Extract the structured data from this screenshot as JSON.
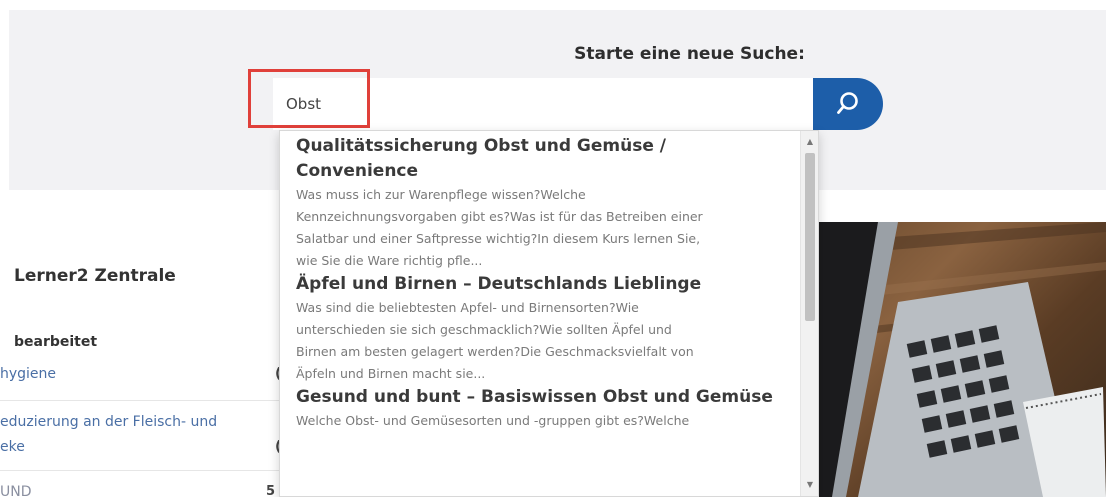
{
  "search": {
    "heading": "Starte eine neue Suche:",
    "query": "Obst"
  },
  "sidebar": {
    "user_title": "Lerner2 Zentrale",
    "section_label": "bearbeitet",
    "courses": [
      {
        "line1": "hygiene"
      },
      {
        "line1": "eduzierung an der Fleisch- und",
        "line2": "eke"
      },
      {
        "line1": "UND",
        "count": "5"
      }
    ]
  },
  "suggestions": [
    {
      "title_line1": "Qualitätssicherung Obst und Gemüse /",
      "title_line2": "Convenience",
      "desc": [
        "Was muss ich zur Warenpflege wissen?Welche",
        "Kennzeichnungsvorgaben gibt es?Was ist für das Betreiben einer",
        "Salatbar und einer Saftpresse wichtig?In diesem Kurs lernen Sie,",
        "wie Sie die Ware richtig pfle..."
      ]
    },
    {
      "title_line1": "Äpfel und Birnen – Deutschlands Lieblinge",
      "desc": [
        "Was sind die beliebtesten Apfel- und Birnensorten?Wie",
        "unterschieden sie sich geschmacklich?Wie sollten Äpfel und",
        "Birnen am besten gelagert werden?Die Geschmacksvielfalt von",
        "Äpfeln und Birnen macht sie..."
      ]
    },
    {
      "title_line1": "Gesund und bunt – Basiswissen Obst und Gemüse",
      "desc": [
        "Welche Obst- und Gemüsesorten und -gruppen gibt es?Welche"
      ]
    }
  ],
  "icons": {
    "search": "search-icon",
    "scroll_up": "triangle-up-icon",
    "scroll_down": "triangle-down-icon"
  },
  "colors": {
    "accent": "#1d5ea9",
    "highlight": "#e0403a",
    "band": "#f2f2f4"
  }
}
